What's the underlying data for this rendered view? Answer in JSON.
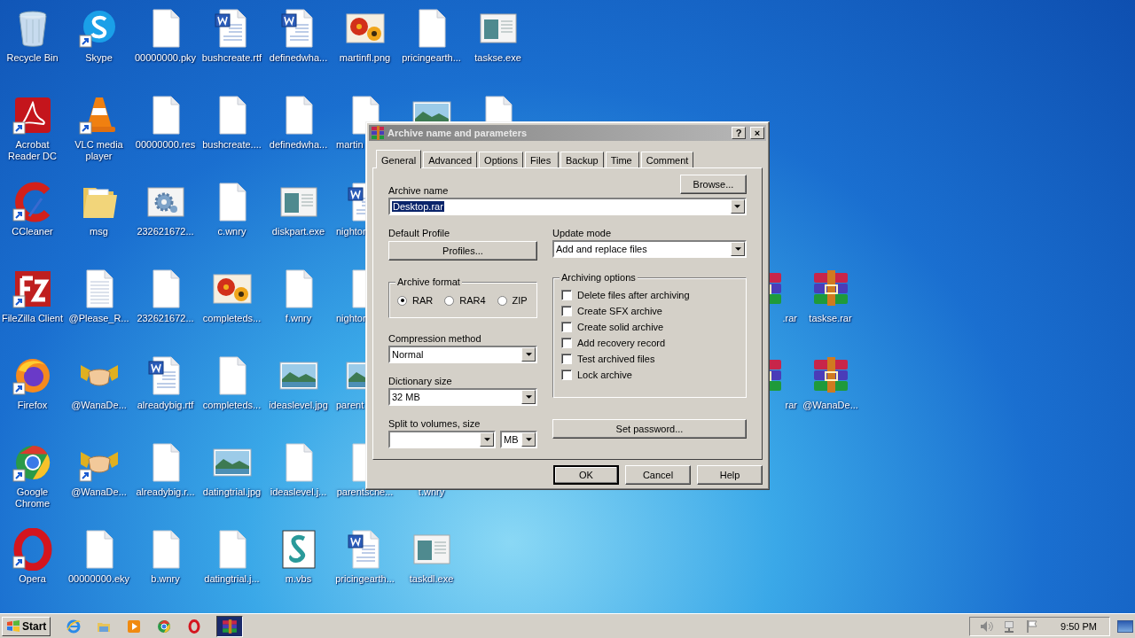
{
  "desktop": {
    "icon_columns": [
      [
        {
          "label": "Recycle Bin",
          "kind": "recycle",
          "shortcut": false
        },
        {
          "label": "Acrobat Reader DC",
          "kind": "acrobat",
          "shortcut": true
        },
        {
          "label": "CCleaner",
          "kind": "ccleaner",
          "shortcut": true
        },
        {
          "label": "FileZilla Client",
          "kind": "filezilla",
          "shortcut": true
        },
        {
          "label": "Firefox",
          "kind": "firefox",
          "shortcut": true
        },
        {
          "label": "Google Chrome",
          "kind": "chrome",
          "shortcut": true
        },
        {
          "label": "Opera",
          "kind": "opera",
          "shortcut": true
        }
      ],
      [
        {
          "label": "Skype",
          "kind": "skype",
          "shortcut": true
        },
        {
          "label": "VLC media player",
          "kind": "vlc",
          "shortcut": true
        },
        {
          "label": "msg",
          "kind": "folder",
          "shortcut": false
        },
        {
          "label": "@Please_R...",
          "kind": "lined",
          "shortcut": false
        },
        {
          "label": "@WanaDe...",
          "kind": "handshake",
          "shortcut": false
        },
        {
          "label": "@WanaDe...",
          "kind": "handshake",
          "shortcut": true
        },
        {
          "label": "00000000.eky",
          "kind": "blank",
          "shortcut": false
        }
      ],
      [
        {
          "label": "00000000.pky",
          "kind": "blank",
          "shortcut": false
        },
        {
          "label": "00000000.res",
          "kind": "blank",
          "shortcut": false
        },
        {
          "label": "232621672...",
          "kind": "gear",
          "shortcut": false
        },
        {
          "label": "232621672...",
          "kind": "blank",
          "shortcut": false
        },
        {
          "label": "alreadybig.rtf",
          "kind": "word",
          "shortcut": false
        },
        {
          "label": "alreadybig.r...",
          "kind": "blank",
          "shortcut": false
        },
        {
          "label": "b.wnry",
          "kind": "blank",
          "shortcut": false
        }
      ],
      [
        {
          "label": "bushcreate.rtf",
          "kind": "word",
          "shortcut": false
        },
        {
          "label": "bushcreate....",
          "kind": "blank",
          "shortcut": false
        },
        {
          "label": "c.wnry",
          "kind": "blank",
          "shortcut": false
        },
        {
          "label": "completeds...",
          "kind": "flower",
          "shortcut": false
        },
        {
          "label": "completeds...",
          "kind": "blank",
          "shortcut": false
        },
        {
          "label": "datingtrial.jpg",
          "kind": "landscape",
          "shortcut": false
        },
        {
          "label": "datingtrial.j...",
          "kind": "blank",
          "shortcut": false
        }
      ],
      [
        {
          "label": "definedwha...",
          "kind": "word",
          "shortcut": false
        },
        {
          "label": "definedwha...",
          "kind": "blank",
          "shortcut": false
        },
        {
          "label": "diskpart.exe",
          "kind": "exe",
          "shortcut": false
        },
        {
          "label": "f.wnry",
          "kind": "blank",
          "shortcut": false
        },
        {
          "label": "ideaslevel.jpg",
          "kind": "landscape",
          "shortcut": false
        },
        {
          "label": "ideaslevel.j...",
          "kind": "blank",
          "shortcut": false
        },
        {
          "label": "m.vbs",
          "kind": "script",
          "shortcut": false
        }
      ],
      [
        {
          "label": "martinfl.png",
          "kind": "flower",
          "shortcut": false
        },
        {
          "label": "martin",
          "kind": "blank",
          "shortcut": false
        },
        {
          "label": "nightor",
          "kind": "word",
          "shortcut": false
        },
        {
          "label": "nightor",
          "kind": "blank",
          "shortcut": false
        },
        {
          "label": "parent",
          "kind": "landscape",
          "shortcut": false
        },
        {
          "label": "parentsche...",
          "kind": "blank",
          "shortcut": false
        },
        {
          "label": "pricingearth...",
          "kind": "word",
          "shortcut": false
        }
      ],
      [
        {
          "label": "pricingearth...",
          "kind": "blank",
          "shortcut": false
        },
        {
          "kind": "landscape"
        },
        {
          "kind": "covered"
        },
        {
          "kind": "covered"
        },
        {
          "kind": "covered"
        },
        {
          "label": "t.wnry",
          "kind": "covered"
        },
        {
          "label": "taskdl.exe",
          "kind": "exe",
          "shortcut": false
        }
      ],
      [
        {
          "label": "taskse.exe",
          "kind": "exe",
          "shortcut": false
        },
        {
          "kind": "blank"
        }
      ]
    ],
    "right_icon_columns": [
      [
        {
          "label": ".rar",
          "kind": "rar"
        },
        {
          "label": "rar",
          "kind": "rar"
        }
      ],
      [
        {
          "label": "taskse.rar",
          "kind": "rar",
          "shortcut": false
        },
        {
          "label": "@WanaDe...",
          "kind": "rar",
          "shortcut": false
        }
      ]
    ]
  },
  "dialog": {
    "title": "Archive name and parameters",
    "help_button": "?",
    "close_button": "×",
    "tabs": [
      {
        "label": "General",
        "selected": true
      },
      {
        "label": "Advanced",
        "selected": false
      },
      {
        "label": "Options",
        "selected": false
      },
      {
        "label": "Files",
        "selected": false
      },
      {
        "label": "Backup",
        "selected": false
      },
      {
        "label": "Time",
        "selected": false
      },
      {
        "label": "Comment",
        "selected": false
      }
    ],
    "archive_name": {
      "label": "Archive name",
      "value": "Desktop.rar",
      "selected": true
    },
    "browse_button": "Browse...",
    "default_profile": {
      "label": "Default Profile",
      "button": "Profiles..."
    },
    "update_mode": {
      "label": "Update mode",
      "value": "Add and replace files"
    },
    "archive_format": {
      "label": "Archive format",
      "options": [
        {
          "label": "RAR",
          "selected": true
        },
        {
          "label": "RAR4",
          "selected": false
        },
        {
          "label": "ZIP",
          "selected": false
        }
      ]
    },
    "compression_method": {
      "label": "Compression method",
      "value": "Normal"
    },
    "dictionary_size": {
      "label": "Dictionary size",
      "value": "32 MB"
    },
    "split_volumes": {
      "label": "Split to volumes, size",
      "unit": "MB"
    },
    "archiving_options": {
      "label": "Archiving options",
      "options": [
        {
          "label": "Delete files after archiving",
          "checked": false
        },
        {
          "label": "Create SFX archive",
          "checked": false
        },
        {
          "label": "Create solid archive",
          "checked": false
        },
        {
          "label": "Add recovery record",
          "checked": false
        },
        {
          "label": "Test archived files",
          "checked": false
        },
        {
          "label": "Lock archive",
          "checked": false
        }
      ]
    },
    "set_password_button": "Set password...",
    "buttons": [
      {
        "label": "OK",
        "default": true
      },
      {
        "label": "Cancel",
        "default": false
      },
      {
        "label": "Help",
        "default": false
      }
    ]
  },
  "taskbar": {
    "start": "Start",
    "quick_launch": [
      {
        "kind": "ie"
      },
      {
        "kind": "explorer"
      },
      {
        "kind": "media"
      },
      {
        "kind": "chrome"
      },
      {
        "kind": "opera"
      }
    ],
    "tasks": [
      {
        "kind": "winrar",
        "active": true
      }
    ],
    "tray": {
      "icons": [
        {
          "kind": "volume"
        },
        {
          "kind": "network"
        },
        {
          "kind": "flag"
        }
      ],
      "clock": "9:50 PM"
    }
  }
}
